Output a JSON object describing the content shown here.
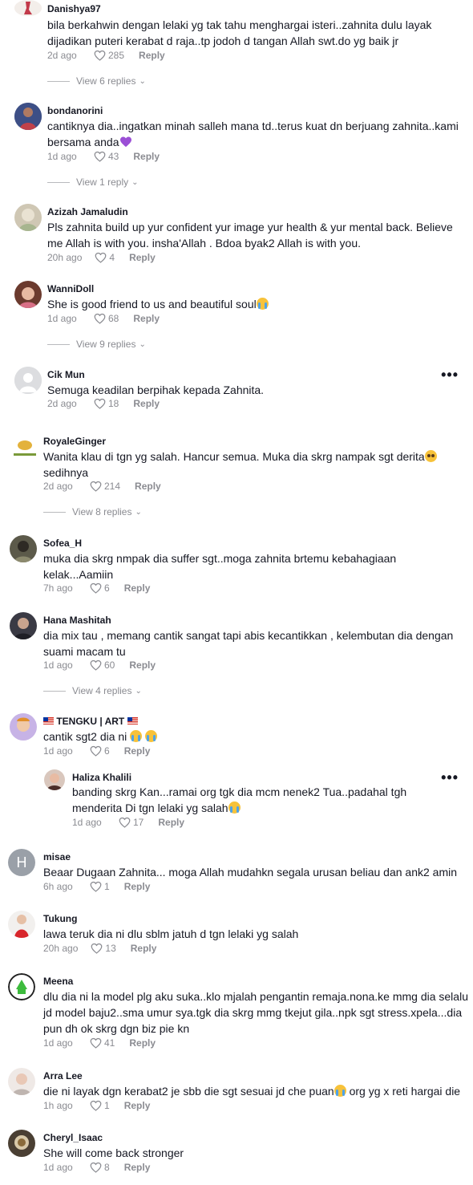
{
  "comments": [
    {
      "user": "Danishya97",
      "text": "bila berkahwin dengan lelaki yg tak tahu menghargai isteri..zahnita dulu layak dijadikan puteri kerabat d raja..tp jodoh d tangan Allah swt.do yg baik jr",
      "time": "2d ago",
      "likes": "285",
      "reply": "Reply",
      "view_replies": "View 6 replies"
    },
    {
      "user": "bondanorini",
      "text": "cantiknya dia..ingatkan minah salleh mana td..terus kuat dn berjuang zahnita..kami bersama anda",
      "time": "1d ago",
      "likes": "43",
      "reply": "Reply",
      "view_replies": "View 1 reply"
    },
    {
      "user": "Azizah Jamaludin",
      "text": "Pls zahnita build up yur confident yur image yur health & yur mental back. Believe me Allah is with you. insha'Allah . Bdoa byak2 Allah is with you.",
      "time": "20h ago",
      "likes": "4",
      "reply": "Reply"
    },
    {
      "user": "WanniDoll",
      "text": "She is good friend to us and beautiful soul",
      "time": "1d ago",
      "likes": "68",
      "reply": "Reply",
      "view_replies": "View 9 replies"
    },
    {
      "user": "Cik Mun",
      "text": "Semuga keadilan berpihak kepada Zahnita.",
      "time": "2d ago",
      "likes": "18",
      "reply": "Reply"
    },
    {
      "user": "RoyaleGinger",
      "text": "Wanita klau di tgn yg salah. Hancur semua. Muka dia skrg nampak sgt derita",
      "text2": "sedihnya",
      "time": "2d ago",
      "likes": "214",
      "reply": "Reply",
      "view_replies": "View 8 replies"
    },
    {
      "user": "Sofea_H",
      "text": "muka dia skrg nmpak dia suffer sgt..moga zahnita brtemu kebahagiaan kelak...Aamiin",
      "time": "7h ago",
      "likes": "6",
      "reply": "Reply"
    },
    {
      "user": "Hana Mashitah",
      "text": "dia mix tau , memang cantik sangat tapi abis kecantikkan , kelembutan dia dengan suami macam tu",
      "time": "1d ago",
      "likes": "60",
      "reply": "Reply",
      "view_replies": "View 4 replies"
    },
    {
      "user": "TENGKU | ART",
      "text": "cantik sgt2 dia ni",
      "time": "1d ago",
      "likes": "6",
      "reply": "Reply"
    },
    {
      "user": "Haliza Khalili",
      "text": "banding skrg Kan...ramai org tgk dia mcm nenek2 Tua..padahal tgh menderita Di tgn lelaki yg salah",
      "time": "1d ago",
      "likes": "17",
      "reply": "Reply"
    },
    {
      "user": "misae",
      "avatar_letter": "H",
      "text": "Beaar Dugaan Zahnita... moga Allah mudahkn segala urusan beliau dan ank2 amin",
      "time": "6h ago",
      "likes": "1",
      "reply": "Reply"
    },
    {
      "user": "Tukung",
      "text": "lawa teruk dia ni dlu sblm jatuh d tgn lelaki yg salah",
      "time": "20h ago",
      "likes": "13",
      "reply": "Reply"
    },
    {
      "user": "Meena",
      "text": "dlu dia ni la model plg aku suka..klo mjalah pengantin remaja.nona.ke mmg dia selalu jd model baju2..sma umur sya.tgk dia skrg mmg tkejut gila..npk sgt stress.xpela...dia pun dh ok skrg dgn biz pie kn",
      "time": "1d ago",
      "likes": "41",
      "reply": "Reply"
    },
    {
      "user": "Arra Lee",
      "text": "die ni layak dgn kerabat2 je sbb die sgt sesuai jd che puan",
      "text2": "org yg x reti hargai die",
      "time": "1h ago",
      "likes": "1",
      "reply": "Reply"
    },
    {
      "user": "Cheryl_Isaac",
      "text": "She will come back stronger",
      "time": "1d ago",
      "likes": "8",
      "reply": "Reply"
    }
  ],
  "colors": {
    "text": "#161823",
    "muted": "#8a8b91",
    "emoji_purple_heart": "#9b4fd6",
    "emoji_face": "#f7c23a"
  },
  "icons": {
    "like": "heart-outline-icon",
    "more": "more-dots-icon",
    "expand": "chevron-down-icon"
  }
}
